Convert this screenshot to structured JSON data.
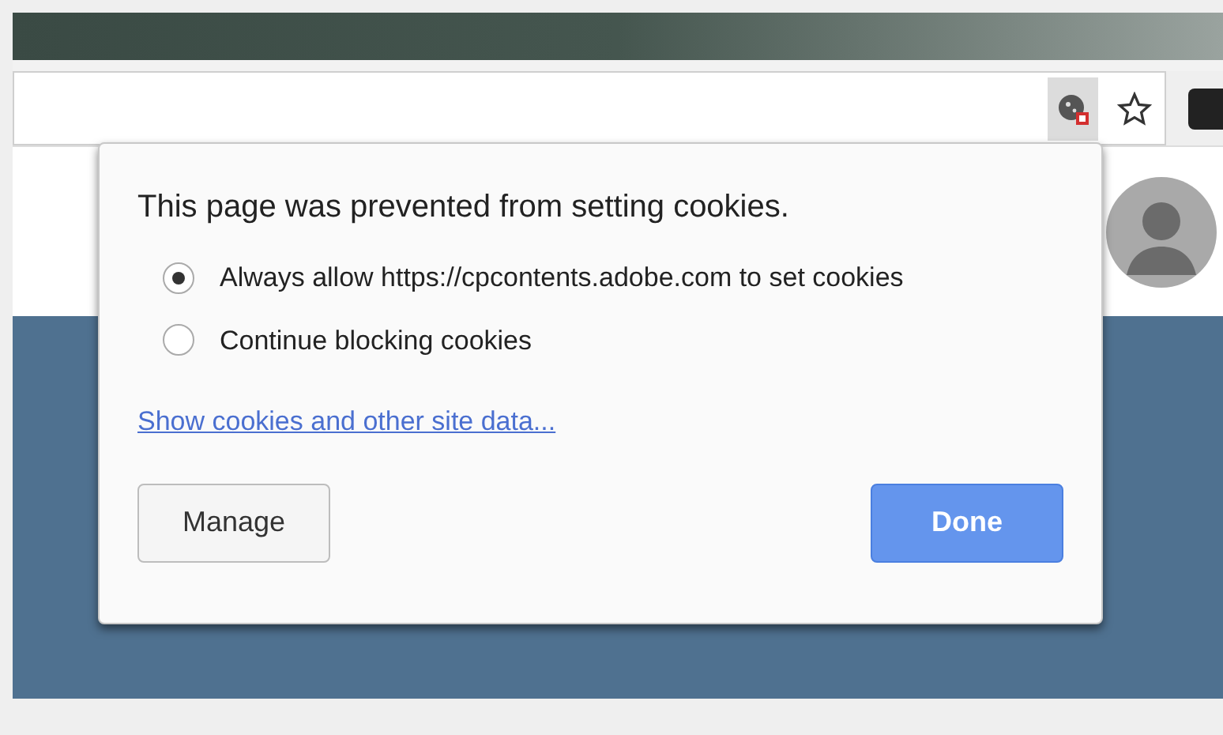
{
  "popup": {
    "title": "This page was prevented from setting cookies.",
    "options": [
      {
        "label": "Always allow https://cpcontents.adobe.com to set cookies",
        "selected": true
      },
      {
        "label": "Continue blocking cookies",
        "selected": false
      }
    ],
    "link": "Show cookies and other site data...",
    "buttons": [
      {
        "label": "Manage",
        "kind": "secondary"
      },
      {
        "label": "Done",
        "kind": "primary"
      }
    ]
  }
}
